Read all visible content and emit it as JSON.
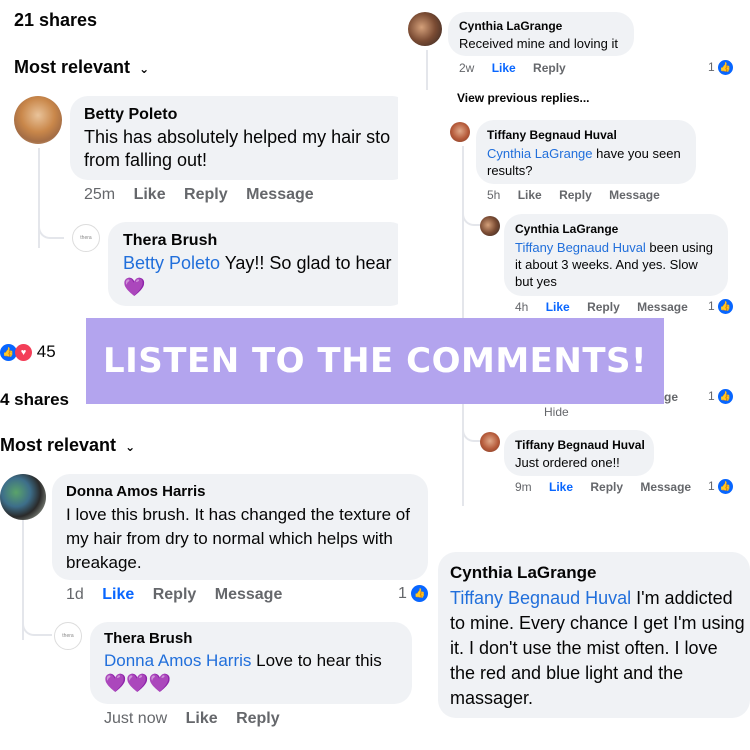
{
  "top_left": {
    "shares": "21 shares",
    "sort": "Most relevant",
    "comment1": {
      "author": "Betty Poleto",
      "text": "This has absolutely helped my hair sto",
      "text2": "from falling out!",
      "time": "25m",
      "like": "Like",
      "reply": "Reply",
      "message": "Message"
    },
    "reply1": {
      "author": "Thera Brush",
      "mention": "Betty Poleto",
      "text": " Yay!! So glad to hear",
      "emoji": "💜"
    }
  },
  "top_right": {
    "c1": {
      "author": "Cynthia LaGrange",
      "text": "Received mine and loving it",
      "time": "2w",
      "like": "Like",
      "reply": "Reply",
      "count": "1"
    },
    "view_previous": "View previous replies...",
    "c2": {
      "author": "Tiffany Begnaud Huval",
      "mention": "Cynthia LaGrange",
      "text": " have you seen results?",
      "time": "5h",
      "like": "Like",
      "reply": "Reply",
      "message": "Message"
    },
    "c3": {
      "author": "Cynthia LaGrange",
      "mention": "Tiffany Begnaud Huval",
      "text": " been using it about 3 weeks.  And yes. Slow but yes",
      "time": "4h",
      "like": "Like",
      "reply": "Reply",
      "message": "Message",
      "count": "1"
    },
    "partial": {
      "hide": "Hide",
      "ge": "ge",
      "count": "1"
    },
    "c4": {
      "author": "Tiffany Begnaud Huval",
      "text": "Just ordered one!!",
      "time": "9m",
      "like": "Like",
      "reply": "Reply",
      "message": "Message",
      "count": "1"
    }
  },
  "banner": {
    "text": "LISTEN TO THE COMMENTS!"
  },
  "middle_left": {
    "reactions": "45",
    "shares": "4 shares",
    "sort": "Most relevant"
  },
  "bottom_left": {
    "c1": {
      "author": "Donna Amos Harris",
      "text": "I love this brush. It has changed the texture of my hair from dry to normal which helps with breakage.",
      "time": "1d",
      "like": "Like",
      "reply": "Reply",
      "message": "Message",
      "count": "1"
    },
    "r1": {
      "author": "Thera Brush",
      "mention": "Donna Amos Harris",
      "text": " Love to hear this",
      "emoji": "💜💜💜",
      "time": "Just now",
      "like": "Like",
      "reply": "Reply"
    }
  },
  "bottom_right": {
    "author": "Cynthia LaGrange",
    "mention": "Tiffany Begnaud Huval",
    "text": " I'm addicted to mine.  Every chance I get I'm using it.  I don't use the mist often.  I love the red and blue light and the massager."
  },
  "icons": {
    "like_badge": "thumbs-up",
    "love_badge": "heart",
    "chevron": "chevron-down"
  },
  "colors": {
    "link": "#216fdb",
    "like_active": "#0866ff",
    "banner": "#b3a4ee",
    "bubble": "#f0f2f5"
  }
}
